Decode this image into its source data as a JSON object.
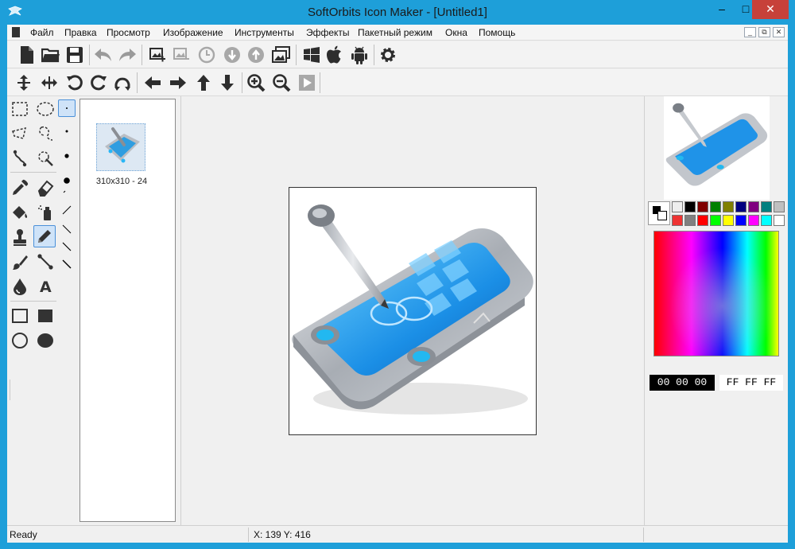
{
  "window": {
    "title": "SoftOrbits Icon Maker - [Untitled1]"
  },
  "menu": [
    "Файл",
    "Правка",
    "Просмотр",
    "Изображение",
    "Инструменты",
    "Эффекты",
    "Пакетный режим",
    "Окна",
    "Помощь"
  ],
  "thumbnail": {
    "label": "310x310 - 24"
  },
  "colors": {
    "foreground_hex": "00 00 00",
    "background_hex": "FF FF FF",
    "palette_row1": [
      "#000000",
      "#800000",
      "#008000",
      "#808000",
      "#000080",
      "#800080",
      "#008080",
      "#c0c0c0"
    ],
    "palette_row2": [
      "#808080",
      "#ff0000",
      "#00ff00",
      "#ffff00",
      "#0000ff",
      "#ff00ff",
      "#00ffff",
      "#ffffff"
    ]
  },
  "status": {
    "state": "Ready",
    "coords": "X: 139 Y: 416"
  }
}
